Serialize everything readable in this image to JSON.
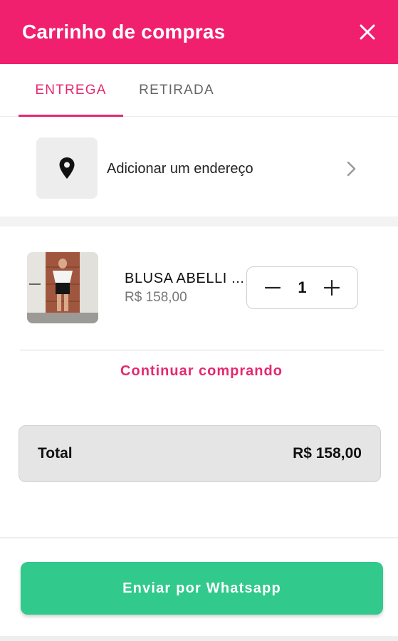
{
  "header": {
    "title": "Carrinho de compras",
    "close_icon": "close-icon",
    "bg_color": "#f0206f"
  },
  "tabs": [
    {
      "label": "ENTREGA",
      "active": true
    },
    {
      "label": "RETIRADA",
      "active": false
    }
  ],
  "address": {
    "label": "Adicionar um endereço",
    "icon": "location-pin-icon",
    "chevron_icon": "chevron-right-icon"
  },
  "cart": {
    "items": [
      {
        "name": "BLUSA ABELLI ...",
        "price": "R$ 158,00",
        "quantity": "1",
        "image": "product-photo"
      }
    ]
  },
  "continue_label": "Continuar comprando",
  "total": {
    "label": "Total",
    "value": "R$ 158,00"
  },
  "send_button": {
    "label": "Enviar por Whatsapp",
    "color": "#32c98c"
  },
  "accent_color": "#e5296f"
}
